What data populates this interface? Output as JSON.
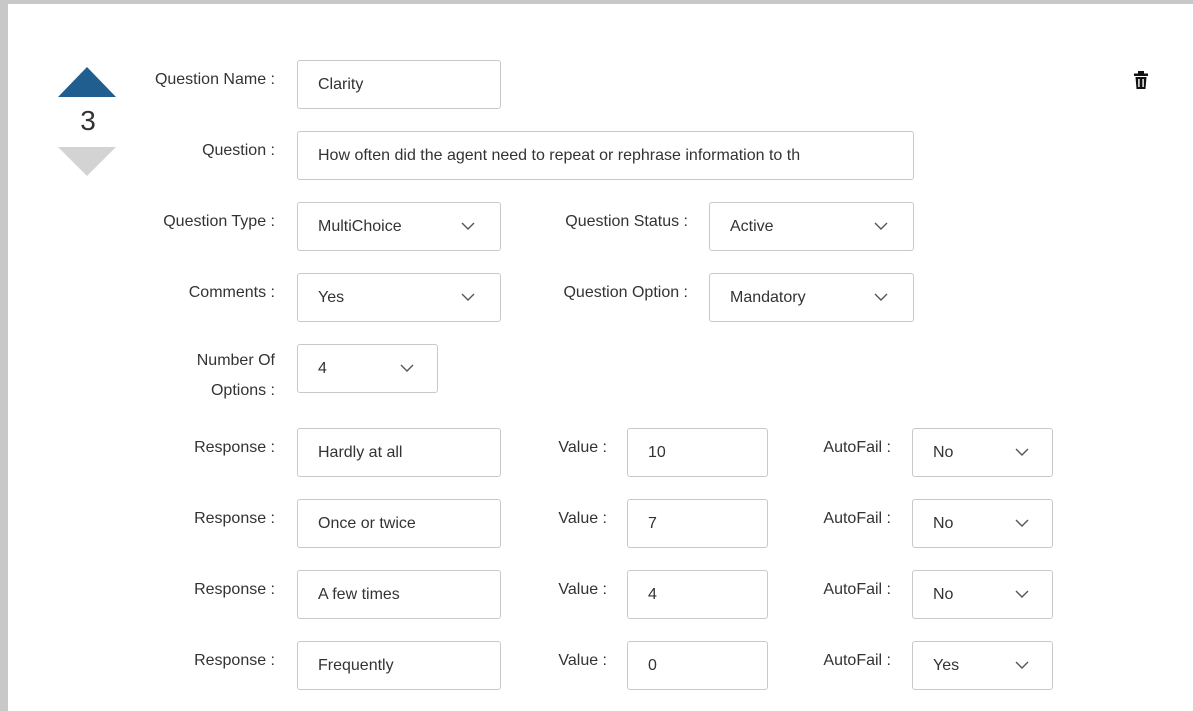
{
  "order": {
    "number": "3"
  },
  "labels": {
    "question_name": "Question Name :",
    "question": "Question :",
    "question_type": "Question Type :",
    "question_status": "Question Status :",
    "comments": "Comments :",
    "question_option": "Question Option :",
    "number_of_options_line1": "Number Of",
    "number_of_options_line2": "Options :",
    "response": "Response :",
    "value": "Value :",
    "autofail": "AutoFail :"
  },
  "fields": {
    "question_name": "Clarity",
    "question": "How often did the agent need to repeat or rephrase information to th",
    "question_type": "MultiChoice",
    "question_status": "Active",
    "comments": "Yes",
    "question_option": "Mandatory",
    "number_of_options": "4"
  },
  "responses": [
    {
      "response": "Hardly at all",
      "value": "10",
      "autofail": "No"
    },
    {
      "response": "Once or twice",
      "value": "7",
      "autofail": "No"
    },
    {
      "response": "A few times",
      "value": "4",
      "autofail": "No"
    },
    {
      "response": "Frequently",
      "value": "0",
      "autofail": "Yes"
    }
  ],
  "icons": {
    "move_up": "triangle-up-icon",
    "move_down": "triangle-down-icon",
    "delete": "trash-icon",
    "dropdown": "chevron-down-icon"
  },
  "colors": {
    "arrow_active": "#1f5e8f",
    "arrow_inactive": "#d3d3d3",
    "frame_border": "#c8c8c8",
    "input_border": "#c9c9c9"
  }
}
